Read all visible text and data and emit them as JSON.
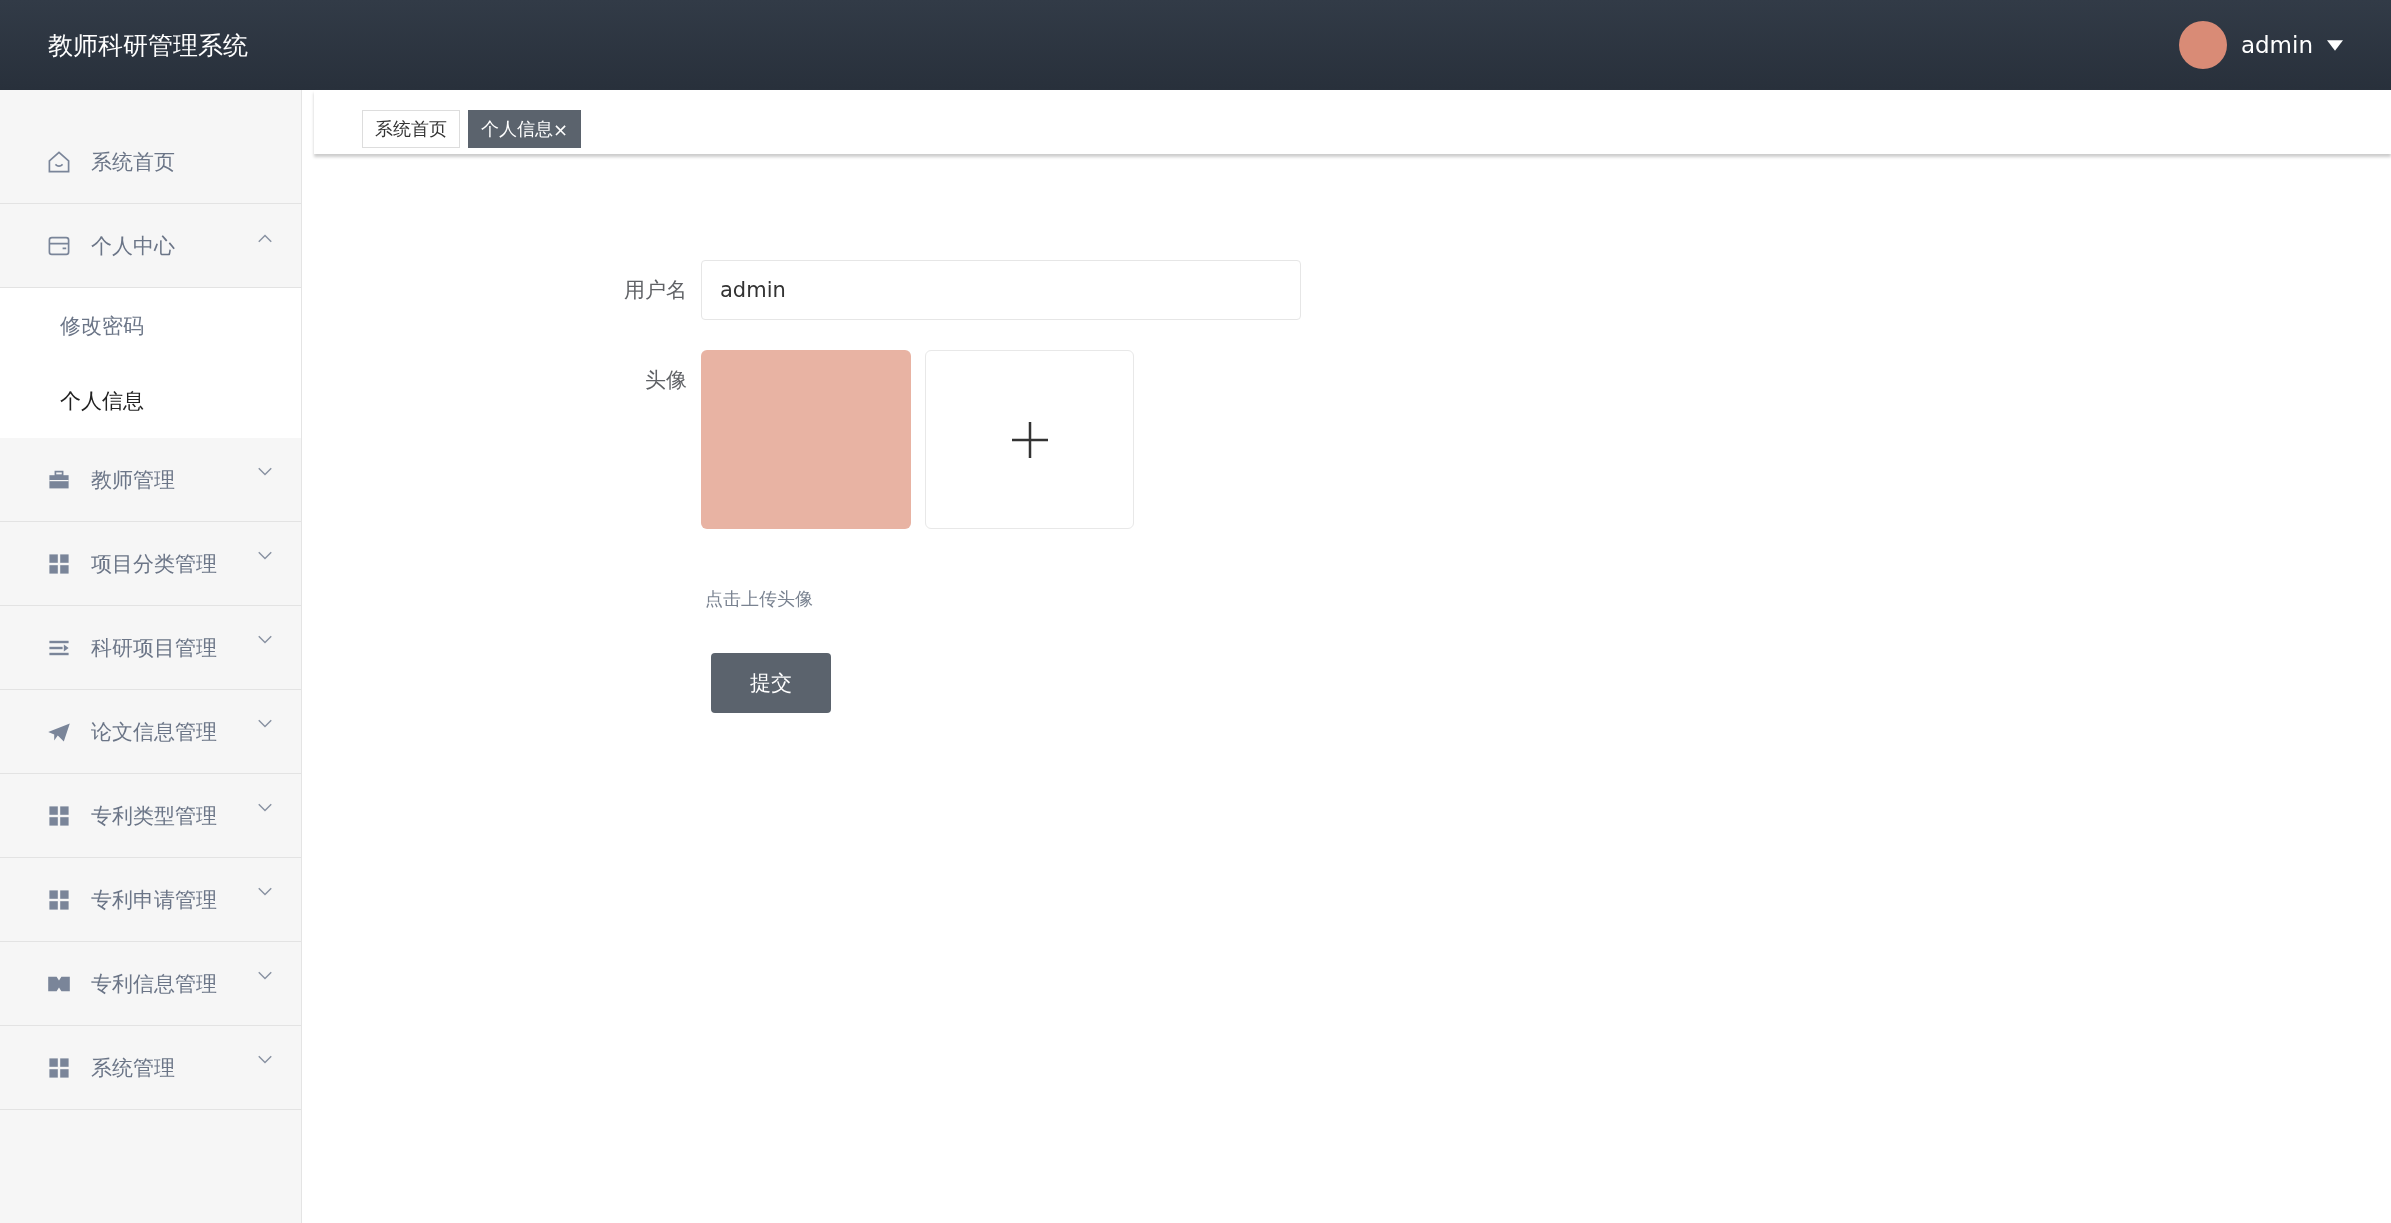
{
  "header": {
    "title": "教师科研管理系统",
    "user": "admin"
  },
  "sidebar": {
    "items": [
      {
        "label": "系统首页",
        "kind": "link"
      },
      {
        "label": "个人中心",
        "kind": "submenu",
        "expanded": true,
        "children": [
          {
            "label": "修改密码",
            "selected": false
          },
          {
            "label": "个人信息",
            "selected": true
          }
        ]
      },
      {
        "label": "教师管理",
        "kind": "submenu",
        "expanded": false
      },
      {
        "label": "项目分类管理",
        "kind": "submenu",
        "expanded": false
      },
      {
        "label": "科研项目管理",
        "kind": "submenu",
        "expanded": false
      },
      {
        "label": "论文信息管理",
        "kind": "submenu",
        "expanded": false
      },
      {
        "label": "专利类型管理",
        "kind": "submenu",
        "expanded": false
      },
      {
        "label": "专利申请管理",
        "kind": "submenu",
        "expanded": false
      },
      {
        "label": "专利信息管理",
        "kind": "submenu",
        "expanded": false
      },
      {
        "label": "系统管理",
        "kind": "submenu",
        "expanded": false
      }
    ]
  },
  "tabs": [
    {
      "label": "系统首页",
      "selected": false
    },
    {
      "label": "个人信息",
      "selected": true,
      "close": "×"
    }
  ],
  "form": {
    "username": {
      "label": "用户名",
      "value": "admin"
    },
    "avatar": {
      "label": "头像",
      "hint": "点击上传头像"
    },
    "submit": "提交"
  }
}
